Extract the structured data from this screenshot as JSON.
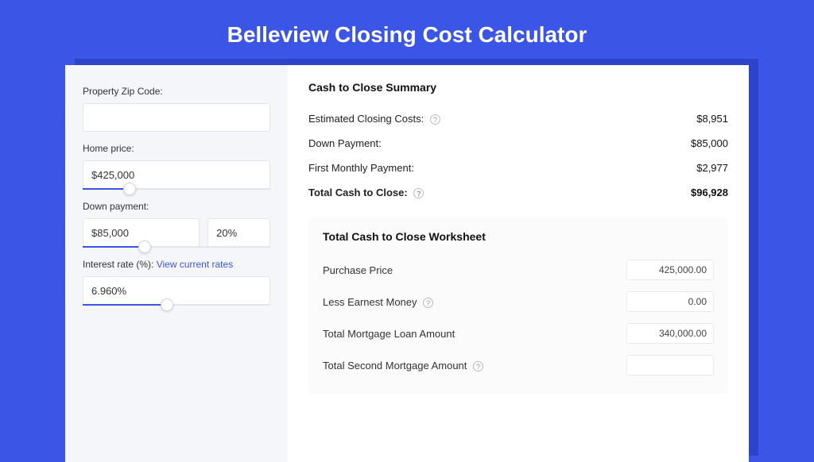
{
  "title": "Belleview Closing Cost Calculator",
  "left": {
    "zip_label": "Property Zip Code:",
    "zip_value": "",
    "home_price_label": "Home price:",
    "home_price_value": "$425,000",
    "down_payment_label": "Down payment:",
    "down_payment_value": "$85,000",
    "down_payment_pct": "20%",
    "interest_label": "Interest rate (%): ",
    "interest_link": "View current rates",
    "interest_value": "6.960%"
  },
  "summary": {
    "title": "Cash to Close Summary",
    "rows": [
      {
        "label": "Estimated Closing Costs:",
        "help": true,
        "value": "$8,951"
      },
      {
        "label": "Down Payment:",
        "help": false,
        "value": "$85,000"
      },
      {
        "label": "First Monthly Payment:",
        "help": false,
        "value": "$2,977"
      }
    ],
    "total_label": "Total Cash to Close:",
    "total_value": "$96,928"
  },
  "worksheet": {
    "title": "Total Cash to Close Worksheet",
    "rows": [
      {
        "label": "Purchase Price",
        "help": false,
        "value": "425,000.00"
      },
      {
        "label": "Less Earnest Money",
        "help": true,
        "value": "0.00"
      },
      {
        "label": "Total Mortgage Loan Amount",
        "help": false,
        "value": "340,000.00"
      },
      {
        "label": "Total Second Mortgage Amount",
        "help": true,
        "value": ""
      }
    ]
  }
}
